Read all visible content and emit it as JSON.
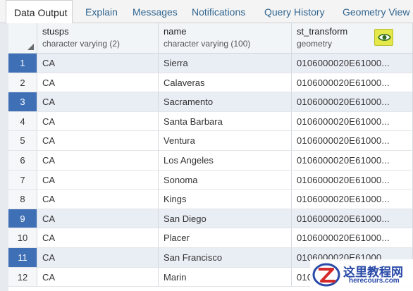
{
  "tabs": [
    {
      "label": "Data Output",
      "active": true
    },
    {
      "label": "Explain"
    },
    {
      "label": "Messages"
    },
    {
      "label": "Notifications"
    },
    {
      "label": "Query History"
    },
    {
      "label": "Geometry View"
    }
  ],
  "columns": [
    {
      "name": "stusps",
      "type": "character varying (2)"
    },
    {
      "name": "name",
      "type": "character varying (100)"
    },
    {
      "name": "st_transform",
      "type": "geometry"
    }
  ],
  "geometry_view_icon": "eye-icon",
  "rows": [
    {
      "num": "1",
      "stusps": "CA",
      "name": "Sierra",
      "geom": "0106000020E61000...",
      "selected": true
    },
    {
      "num": "2",
      "stusps": "CA",
      "name": "Calaveras",
      "geom": "0106000020E61000..."
    },
    {
      "num": "3",
      "stusps": "CA",
      "name": "Sacramento",
      "geom": "0106000020E61000...",
      "selected": true
    },
    {
      "num": "4",
      "stusps": "CA",
      "name": "Santa Barbara",
      "geom": "0106000020E61000..."
    },
    {
      "num": "5",
      "stusps": "CA",
      "name": "Ventura",
      "geom": "0106000020E61000..."
    },
    {
      "num": "6",
      "stusps": "CA",
      "name": "Los Angeles",
      "geom": "0106000020E61000..."
    },
    {
      "num": "7",
      "stusps": "CA",
      "name": "Sonoma",
      "geom": "0106000020E61000..."
    },
    {
      "num": "8",
      "stusps": "CA",
      "name": "Kings",
      "geom": "0106000020E61000..."
    },
    {
      "num": "9",
      "stusps": "CA",
      "name": "San Diego",
      "geom": "0106000020E61000...",
      "selected": true
    },
    {
      "num": "10",
      "stusps": "CA",
      "name": "Placer",
      "geom": "0106000020E61000..."
    },
    {
      "num": "11",
      "stusps": "CA",
      "name": "San Francisco",
      "geom": "0106000020E61000...",
      "selected": true
    },
    {
      "num": "12",
      "stusps": "CA",
      "name": "Marin",
      "geom": "010"
    }
  ],
  "watermark": {
    "title": "这里教程网",
    "url": "herecours.com"
  },
  "colors": {
    "selected_row": "#3f6fb5",
    "tab_link": "#326690",
    "eye_button": "#e4e84a"
  }
}
